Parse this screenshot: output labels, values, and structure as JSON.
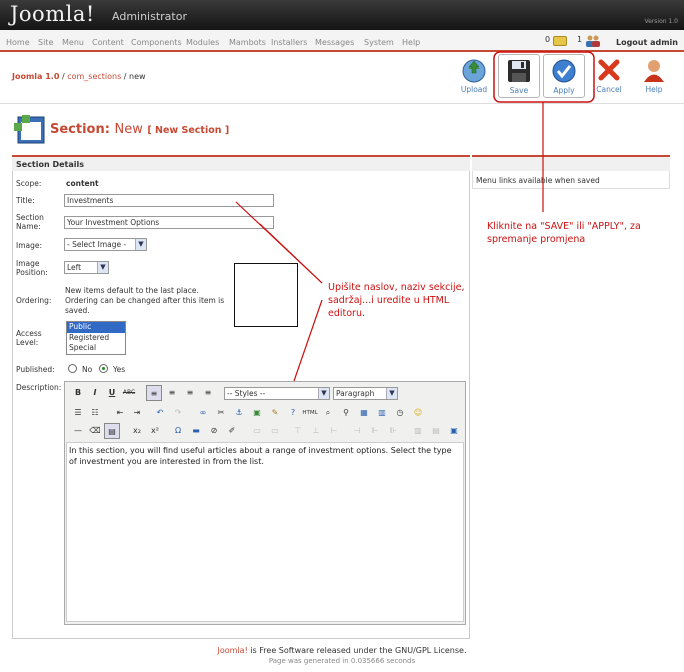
{
  "header": {
    "logo": "Joomla!",
    "subtitle": "Administrator",
    "version": "Version 1.0"
  },
  "menu": {
    "items": [
      "Home",
      "Site",
      "Menu",
      "Content",
      "Components",
      "Modules",
      "Mambots",
      "Installers",
      "Messages",
      "System",
      "Help"
    ],
    "messages_count": "0",
    "users_count": "1",
    "logout": "Logout admin"
  },
  "pathway": {
    "app": "Joomla 1.0",
    "sep1": " / ",
    "component": "com_sections",
    "sep2": " / new"
  },
  "toolbar": [
    {
      "label": "Upload",
      "icon": "upload-icon"
    },
    {
      "label": "Save",
      "icon": "save-icon"
    },
    {
      "label": "Apply",
      "icon": "apply-icon"
    },
    {
      "label": "Cancel",
      "icon": "cancel-icon"
    },
    {
      "label": "Help",
      "icon": "help-icon"
    }
  ],
  "page": {
    "title": "Section:",
    "mode": "New",
    "subtitle": "[ New Section ]"
  },
  "form": {
    "heading": "Section Details",
    "scope_label": "Scope:",
    "scope_value": "content",
    "title_label": "Title:",
    "title_value": "Investments",
    "name_label1": "Section",
    "name_label2": "Name:",
    "name_value": "Your Investment Options",
    "image_label": "Image:",
    "image_value": "- Select Image -",
    "position_label1": "Image",
    "position_label2": "Position:",
    "position_value": "Left",
    "ordering_label": "Ordering:",
    "ordering_line1": "New items default to the last place.",
    "ordering_line2": "Ordering can be changed after this item is",
    "ordering_line3": "saved.",
    "access_label1": "Access",
    "access_label2": "Level:",
    "access_options": [
      "Public",
      "Registered",
      "Special"
    ],
    "published_label": "Published:",
    "published_no": "No",
    "published_yes": "Yes",
    "published_value": "Yes",
    "description_label": "Description:"
  },
  "side": {
    "note": "Menu links available when saved"
  },
  "editor": {
    "styles_value": "-- Styles --",
    "format_value": "Paragraph",
    "content": "In this section, you will find useful articles about a range of investment options. Select the type of investment you are interested in from the list."
  },
  "annotations": {
    "save_note_line1": "Kliknite na \"SAVE\" ili \"APPLY\", za",
    "save_note_line2": "spremanje promjena",
    "edit_note_line1": "Upišite naslov, naziv sekcije,",
    "edit_note_line2": "sadržaj...i uredite u HTML",
    "edit_note_line3": "editoru.",
    "color": "#cc1111"
  },
  "footer": {
    "brand": "Joomla!",
    "license": " is Free Software released under the GNU/GPL License.",
    "generated": "Page was generated in 0.035666 seconds"
  },
  "colors": {
    "accent": "#c64934",
    "link": "#4a7fb5",
    "selection": "#316ac5"
  }
}
